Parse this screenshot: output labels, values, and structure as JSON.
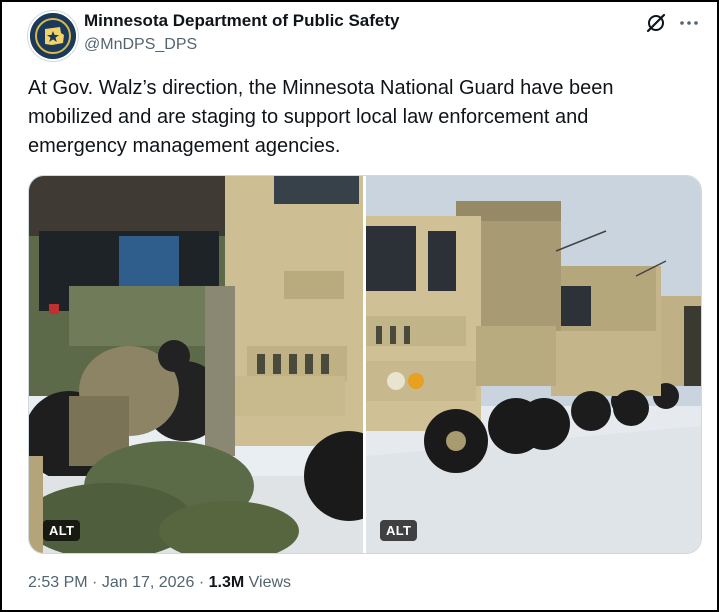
{
  "author": {
    "display_name": "Minnesota Department of Public Safety",
    "handle": "@MnDPS_DPS",
    "avatar_icon": "minnesota-state-seal-icon"
  },
  "header_icons": {
    "grok": "grok-icon",
    "more": "more-options-icon"
  },
  "tweet": {
    "text": "At Gov. Walz’s direction, the Minnesota National Guard have been mobilized and are staging to support local law enforcement and emergency management agencies."
  },
  "media": [
    {
      "alt_label": "ALT"
    },
    {
      "alt_label": "ALT"
    }
  ],
  "meta": {
    "time": "2:53 PM",
    "separator": "·",
    "date": "Jan 17, 2026",
    "views_count": "1.3M",
    "views_label": "Views"
  },
  "colors": {
    "text_primary": "#0f1419",
    "text_secondary": "#536471",
    "border": "#cfd9de",
    "truck_tan": "#cdbf93"
  }
}
